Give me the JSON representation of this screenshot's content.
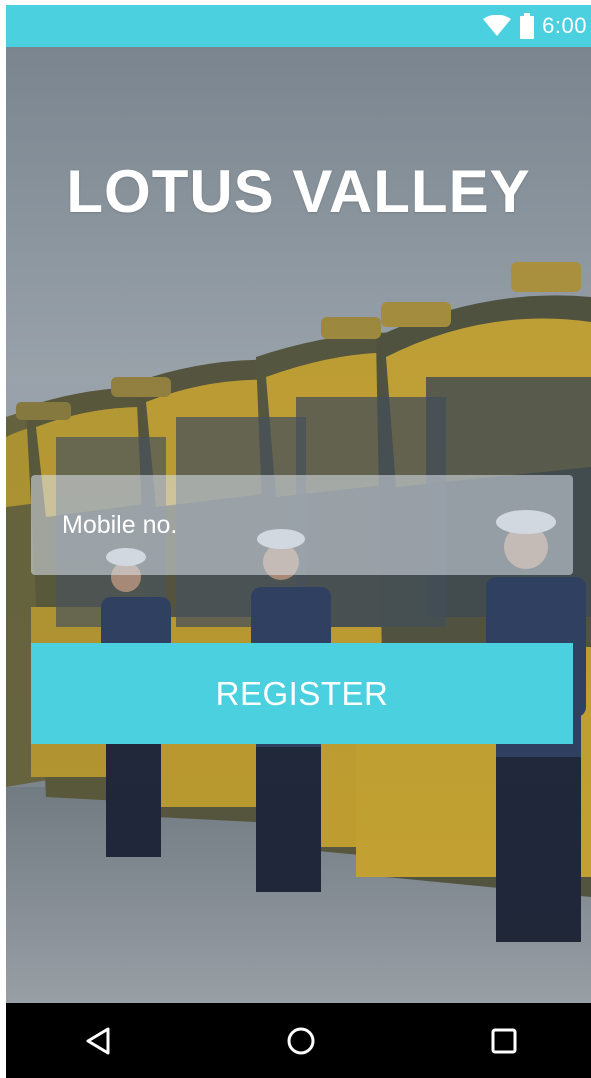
{
  "status_bar": {
    "time": "6:00",
    "icons": [
      "wifi-icon",
      "battery-icon"
    ],
    "background": "#4bd0e0"
  },
  "app": {
    "title": "LOTUS VALLEY",
    "mobile_field": {
      "placeholder": "Mobile no.",
      "value": ""
    },
    "register_button": {
      "label": "REGISTER",
      "color": "#4bd0e0"
    }
  },
  "nav_bar": {
    "buttons": [
      "back-icon",
      "home-icon",
      "recents-icon"
    ]
  }
}
